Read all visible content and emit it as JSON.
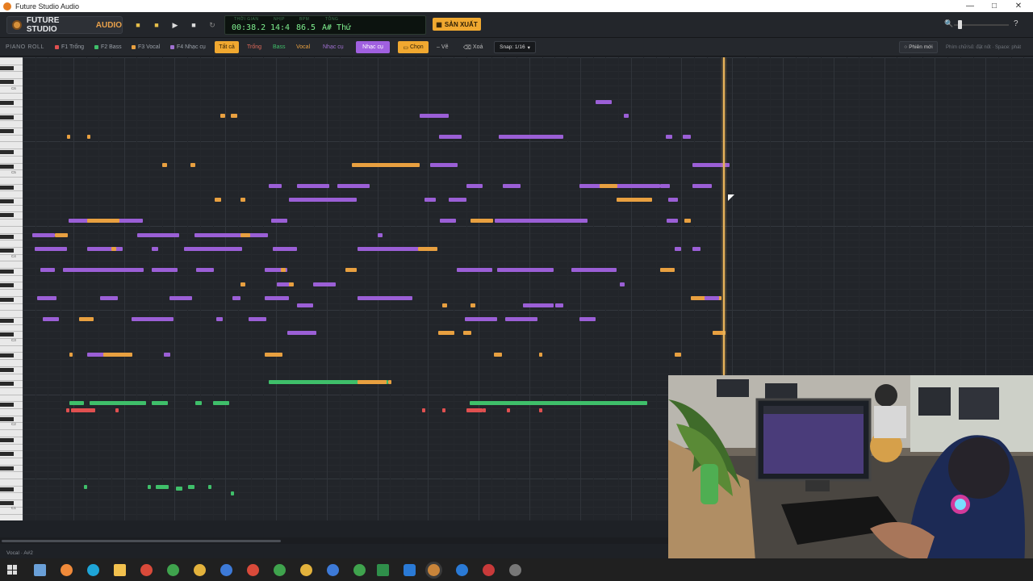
{
  "window": {
    "title": "Future Studio Audio"
  },
  "logo": {
    "main": "FUTURE STUDIO",
    "accent": "AUDIO"
  },
  "transport": {
    "time_caption": "THỜI GIAN",
    "time": "00:38.2",
    "beat_caption": "NHỊP",
    "beat": "14:4",
    "bpm_caption": "BPM",
    "bpm": "86.5",
    "key_caption": "TÔNG",
    "key": "A# Thứ"
  },
  "export_label": "SẢN XUẤT",
  "help_label": "?",
  "filterbar": {
    "section": "PIANO ROLL",
    "tracks": [
      {
        "label": "F1 Trống",
        "color": "#e05050"
      },
      {
        "label": "F2 Bass",
        "color": "#3fbf6a"
      },
      {
        "label": "F3 Vocal",
        "color": "#e8a040"
      },
      {
        "label": "F4 Nhạc cụ",
        "color": "#a070d0"
      }
    ],
    "filters": [
      "Tất cả",
      "Trống",
      "Bass",
      "Vocal",
      "Nhạc cụ"
    ],
    "instrument_btn": "Nhạc cụ",
    "select_btn": "Chọn",
    "draw_btn": "Vẽ",
    "erase_btn": "Xoá",
    "snap": "Snap: 1/16",
    "new_session": "Phiên mới",
    "hint": "Phím chữ/số: đặt nốt · Space: phát"
  },
  "keys": {
    "labels": [
      "C6",
      "C5",
      "C4",
      "C3",
      "C2",
      "C1"
    ]
  },
  "status": "Vocal · A#2",
  "colors": {
    "vocal": "#e8a040",
    "instrument": "#9b5fd6",
    "bass": "#3fbf6a",
    "drums": "#e05050",
    "playhead": "#e8b35a"
  }
}
